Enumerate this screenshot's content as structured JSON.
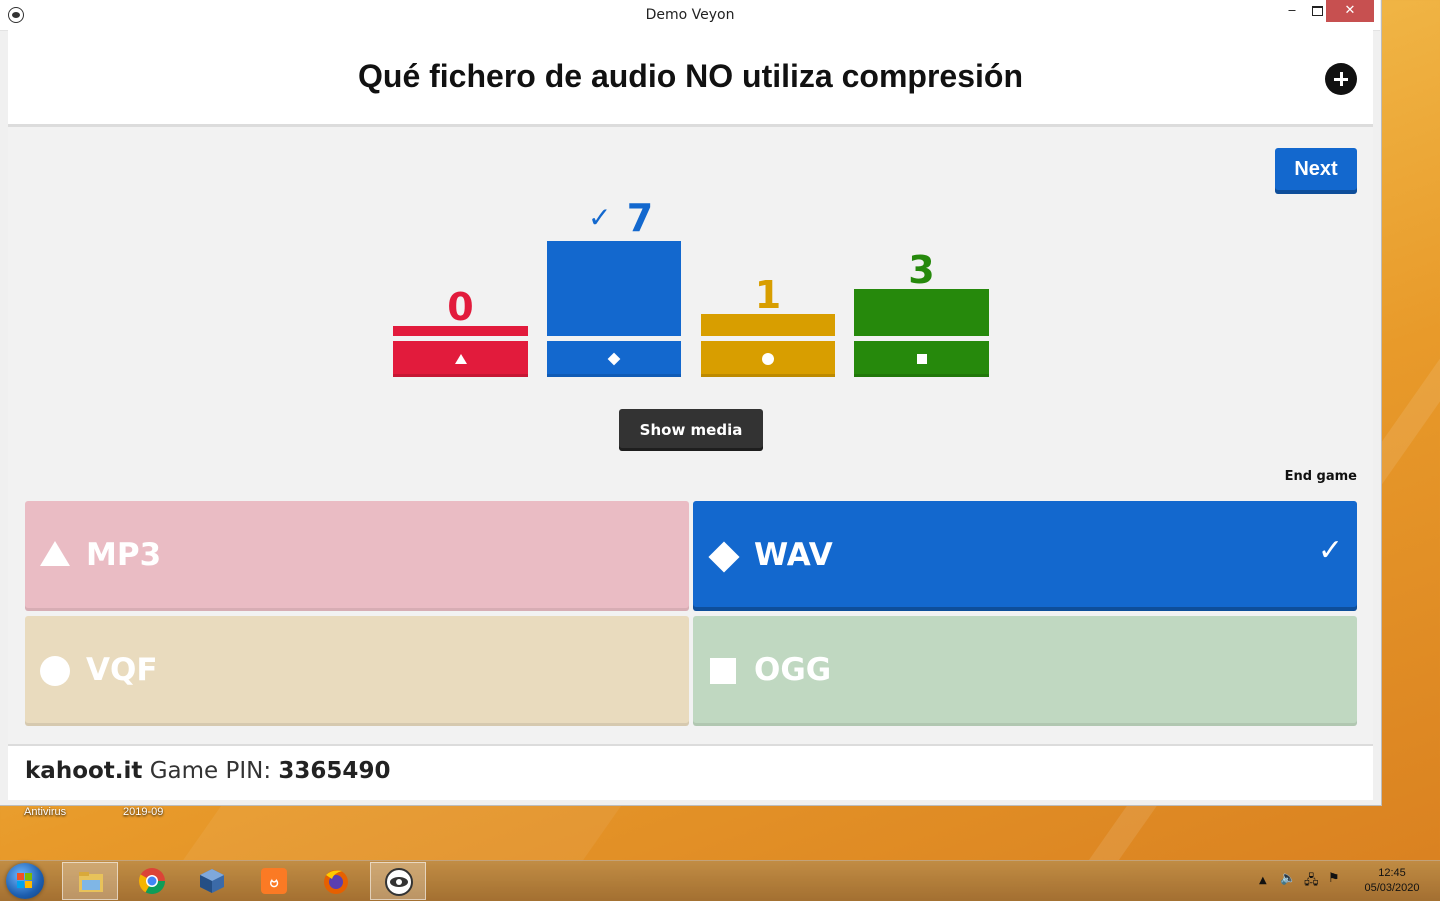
{
  "window": {
    "title": "Demo Veyon",
    "controls": {
      "minimize": "‒",
      "close": "✕"
    }
  },
  "kahoot": {
    "question": "Qué fichero de audio NO utiliza compresión",
    "next_label": "Next",
    "show_media_label": "Show media",
    "end_game_label": "End game",
    "results": [
      {
        "count": "0",
        "shape": "triangle",
        "color": "#e21b3c",
        "correct": false
      },
      {
        "count": "7",
        "shape": "diamond",
        "color": "#1368ce",
        "correct": true
      },
      {
        "count": "1",
        "shape": "circle",
        "color": "#d89e00",
        "correct": false
      },
      {
        "count": "3",
        "shape": "square",
        "color": "#26890c",
        "correct": false
      }
    ],
    "answers": [
      {
        "text": "MP3",
        "shape": "triangle-icon",
        "color": "#eabcc4",
        "correct": false
      },
      {
        "text": "WAV",
        "shape": "diamond-icon",
        "color": "#1368ce",
        "correct": true
      },
      {
        "text": "VQF",
        "shape": "circle-icon",
        "color": "#e9dbbe",
        "correct": false
      },
      {
        "text": "OGG",
        "shape": "square-icon",
        "color": "#c0d8c1",
        "correct": false
      }
    ],
    "footer": {
      "brand": "kahoot.it",
      "pin_label": "Game PIN:",
      "pin": "3365490"
    }
  },
  "desktop": {
    "labels": [
      "Antivirus",
      "2019-09"
    ]
  },
  "taskbar": {
    "apps": [
      "file-explorer-icon",
      "chrome-icon",
      "virtualbox-icon",
      "xampp-icon",
      "firefox-icon",
      "veyon-icon"
    ],
    "clock": {
      "time": "12:45",
      "date": "05/03/2020"
    }
  }
}
